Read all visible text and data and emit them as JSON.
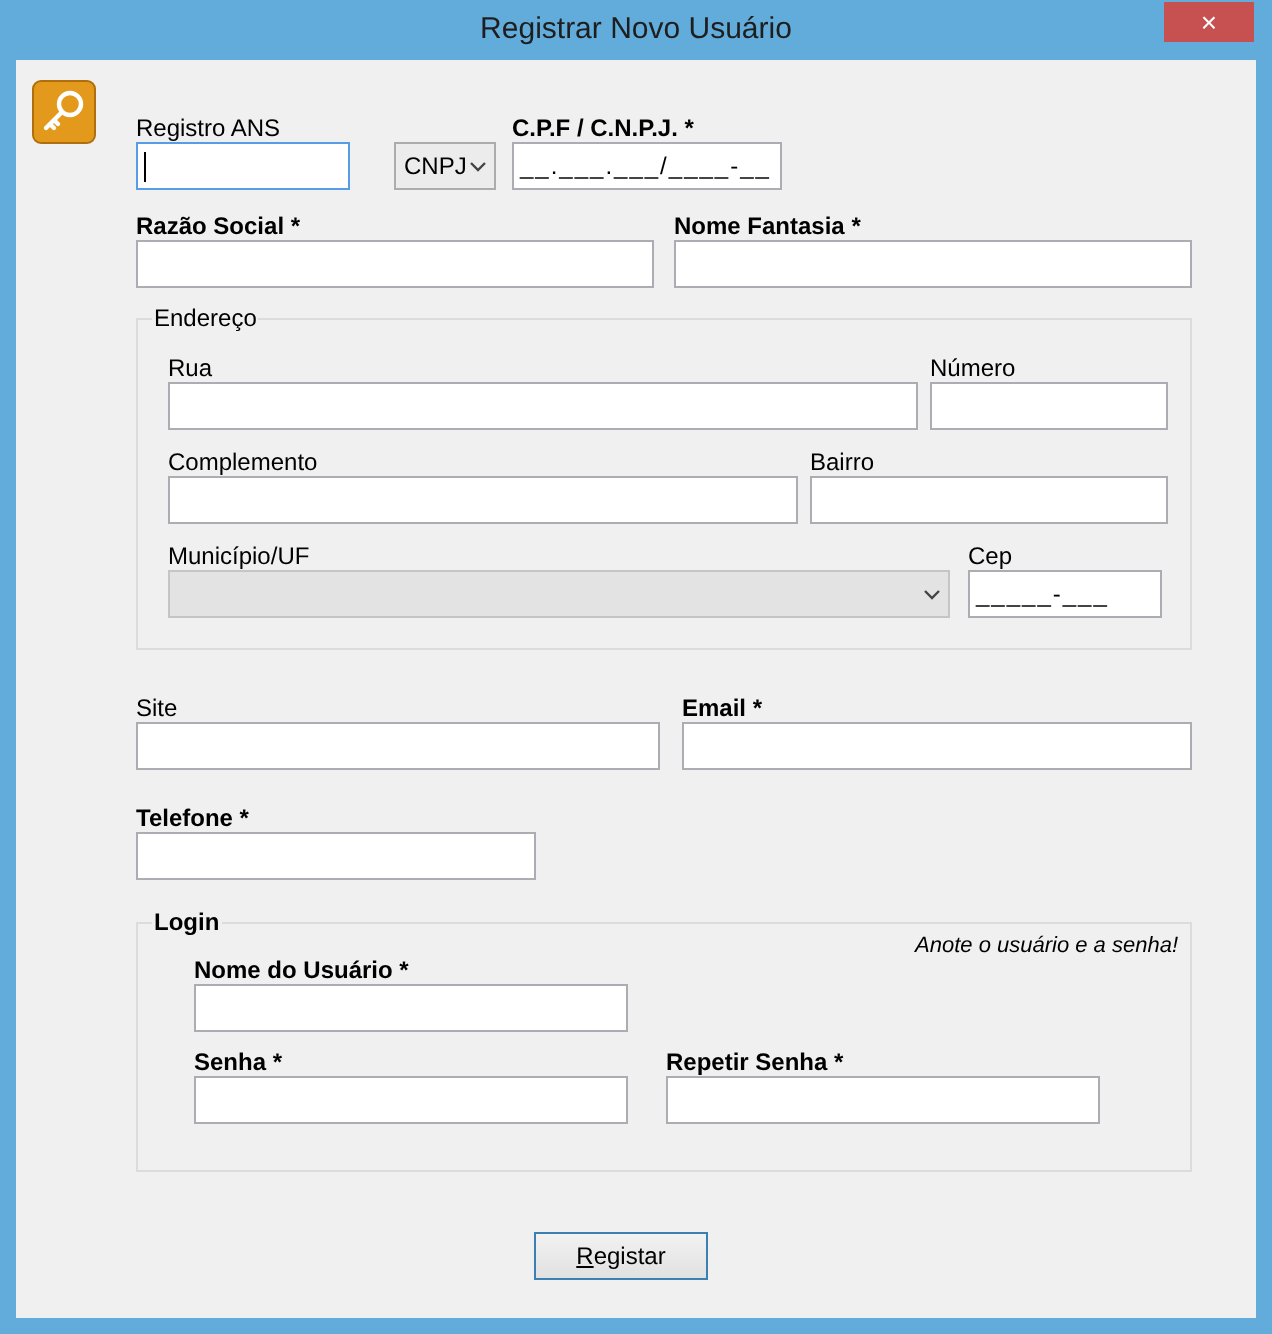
{
  "window": {
    "title": "Registrar Novo Usuário",
    "close_button": "×"
  },
  "top_fields": [
    {
      "kind": "text",
      "label": "Registro ANS",
      "required": false,
      "focused": true
    },
    {
      "kind": "select",
      "value": "CNPJ",
      "disabled": false
    },
    {
      "kind": "text",
      "label": "C.P.F / C.N.P.J. *",
      "required": true,
      "focused": false,
      "value": "__.___.___/____-__"
    },
    {
      "kind": "text",
      "label": "Razão Social *",
      "required": true,
      "focused": false
    },
    {
      "kind": "text",
      "label": "Nome Fantasia *",
      "required": true,
      "focused": false
    }
  ],
  "address": {
    "legend": "Endereço",
    "fields": [
      {
        "kind": "text",
        "label": "Rua",
        "required": false,
        "focused": false
      },
      {
        "kind": "text",
        "label": "Número",
        "required": false,
        "focused": false
      },
      {
        "kind": "text",
        "label": "Complemento",
        "required": false,
        "focused": false
      },
      {
        "kind": "text",
        "label": "Bairro",
        "required": false,
        "focused": false
      },
      {
        "kind": "select",
        "label": "Município/UF",
        "required": false,
        "disabled": true
      },
      {
        "kind": "text",
        "label": "Cep",
        "required": false,
        "focused": false,
        "value": "_____-___"
      }
    ]
  },
  "contact_fields": [
    {
      "kind": "text",
      "label": "Site",
      "required": false,
      "focused": false
    },
    {
      "kind": "text",
      "label": "Email *",
      "required": true,
      "focused": false
    },
    {
      "kind": "text",
      "label": "Telefone *",
      "required": true,
      "focused": false
    }
  ],
  "login": {
    "legend": "Login",
    "hint": "Anote o usuário e a senha!",
    "fields": [
      {
        "kind": "text",
        "label": "Nome do Usuário *",
        "required": true,
        "focused": false
      },
      {
        "kind": "text",
        "label": "Senha *",
        "required": true,
        "focused": false
      },
      {
        "kind": "text",
        "label": "Repetir Senha *",
        "required": true,
        "focused": false
      }
    ]
  },
  "submit_button": {
    "label": "Registar"
  }
}
